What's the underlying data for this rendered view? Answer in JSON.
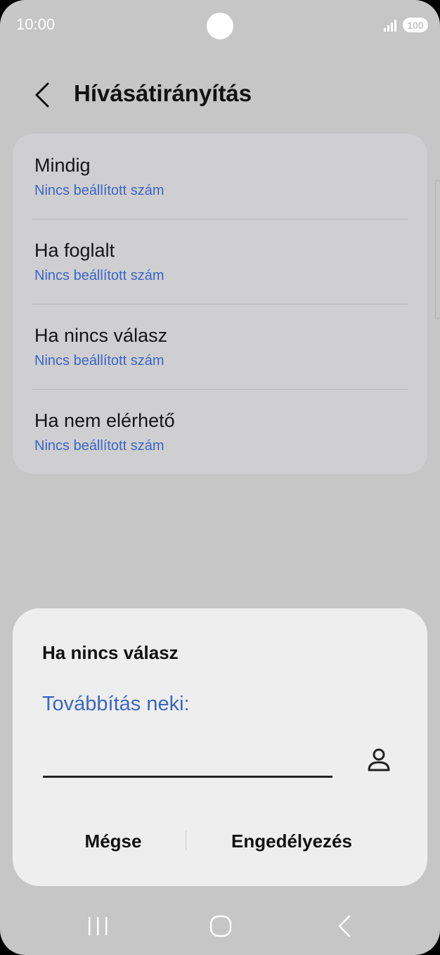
{
  "status_bar": {
    "time": "10:00",
    "battery": "100",
    "icons": [
      "signal-icon",
      "battery-icon"
    ]
  },
  "header": {
    "title": "Hívásátirányítás",
    "back_icon": "chevron-left-icon"
  },
  "forwarding_options": [
    {
      "title": "Mindig",
      "subtitle": "Nincs beállított szám"
    },
    {
      "title": "Ha foglalt",
      "subtitle": "Nincs beállított szám"
    },
    {
      "title": "Ha nincs válasz",
      "subtitle": "Nincs beállított szám"
    },
    {
      "title": "Ha nem elérhető",
      "subtitle": "Nincs beállított szám"
    }
  ],
  "dialog": {
    "title": "Ha nincs válasz",
    "label": "Továbbítás neki:",
    "input_value": "",
    "contact_icon": "person-icon",
    "cancel_label": "Mégse",
    "enable_label": "Engedélyezés"
  },
  "nav_bar": {
    "icons": [
      "recent-apps-icon",
      "home-icon",
      "back-icon"
    ]
  },
  "colors": {
    "accent": "#3b66c4",
    "background": "#c6c6c6",
    "card": "#cfcfd2",
    "dialog": "#eeeeee"
  }
}
